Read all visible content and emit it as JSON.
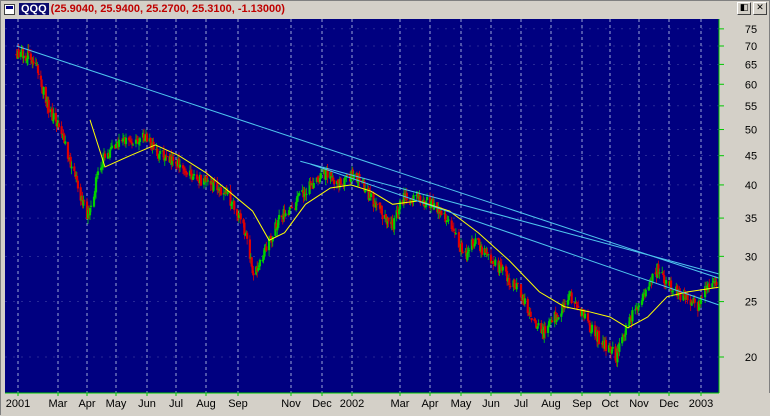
{
  "window": {
    "symbol": "QQQ",
    "quote_values": "(25.9040, 25.9400, 25.2700, 25.3100, -1.13000)",
    "buttons": {
      "restore": "◧",
      "close": "✕"
    }
  },
  "colors": {
    "plot_bg": "#000080",
    "grid": "#9da6d6",
    "up": "#00d000",
    "down": "#e00000",
    "moving_average": "#ffff00",
    "trendline": "#4fc6ee",
    "axis_text": "#000000",
    "axis_frame": "#00c800"
  },
  "chart_data": {
    "type": "candlestick",
    "series_label": "QQQ",
    "y_scale": "log",
    "ylim": [
      18,
      76
    ],
    "y_ticks": [
      20,
      25,
      30,
      35,
      40,
      45,
      50,
      55,
      60,
      65,
      70,
      75
    ],
    "x_ticks": [
      "2001",
      "Mar",
      "Apr",
      "May",
      "Jun",
      "Jul",
      "Aug",
      "Sep",
      "Nov",
      "Dec",
      "2002",
      "Mar",
      "Apr",
      "May",
      "Jun",
      "Jul",
      "Aug",
      "Sep",
      "Oct",
      "Nov",
      "Dec",
      "2003"
    ],
    "price_path": [
      [
        "2001-01-02",
        68
      ],
      [
        "2001-01-25",
        67
      ],
      [
        "2001-02-15",
        55
      ],
      [
        "2001-03-05",
        49
      ],
      [
        "2001-03-20",
        41
      ],
      [
        "2001-04-04",
        35
      ],
      [
        "2001-04-10",
        40
      ],
      [
        "2001-04-20",
        45
      ],
      [
        "2001-05-05",
        47
      ],
      [
        "2001-05-20",
        48
      ],
      [
        "2001-05-28",
        49
      ],
      [
        "2001-06-10",
        46
      ],
      [
        "2001-06-25",
        44
      ],
      [
        "2001-07-10",
        43
      ],
      [
        "2001-07-25",
        41
      ],
      [
        "2001-08-10",
        40
      ],
      [
        "2001-08-25",
        38
      ],
      [
        "2001-09-10",
        34
      ],
      [
        "2001-09-21",
        28
      ],
      [
        "2001-10-05",
        31
      ],
      [
        "2001-10-20",
        35
      ],
      [
        "2001-11-05",
        37
      ],
      [
        "2001-11-20",
        40
      ],
      [
        "2001-12-05",
        42
      ],
      [
        "2001-12-20",
        40
      ],
      [
        "2002-01-05",
        42
      ],
      [
        "2002-01-20",
        39
      ],
      [
        "2002-02-05",
        36
      ],
      [
        "2002-02-20",
        34
      ],
      [
        "2002-03-05",
        38
      ],
      [
        "2002-03-20",
        38
      ],
      [
        "2002-04-05",
        37
      ],
      [
        "2002-04-20",
        34
      ],
      [
        "2002-05-05",
        30
      ],
      [
        "2002-05-15",
        32
      ],
      [
        "2002-06-01",
        30
      ],
      [
        "2002-06-15",
        28
      ],
      [
        "2002-06-30",
        26
      ],
      [
        "2002-07-15",
        23
      ],
      [
        "2002-07-24",
        22
      ],
      [
        "2002-08-10",
        24
      ],
      [
        "2002-08-22",
        25.5
      ],
      [
        "2002-09-05",
        23.5
      ],
      [
        "2002-09-20",
        21.5
      ],
      [
        "2002-10-08",
        20
      ],
      [
        "2002-10-20",
        23
      ],
      [
        "2002-11-05",
        25.5
      ],
      [
        "2002-11-20",
        28.5
      ],
      [
        "2002-12-01",
        27
      ],
      [
        "2002-12-15",
        25.5
      ],
      [
        "2002-12-31",
        24.5
      ],
      [
        "2003-01-08",
        26.5
      ],
      [
        "2003-01-14",
        27.5
      ],
      [
        "2003-01-20",
        25.3
      ]
    ],
    "moving_average_path": [
      [
        "2001-04-05",
        52
      ],
      [
        "2001-04-20",
        43
      ],
      [
        "2001-05-15",
        45
      ],
      [
        "2001-06-10",
        47
      ],
      [
        "2001-07-05",
        45
      ],
      [
        "2001-08-01",
        42
      ],
      [
        "2001-08-25",
        39
      ],
      [
        "2001-09-20",
        36
      ],
      [
        "2001-10-08",
        32
      ],
      [
        "2001-10-25",
        33
      ],
      [
        "2001-11-15",
        37
      ],
      [
        "2001-12-10",
        39.5
      ],
      [
        "2002-01-01",
        40
      ],
      [
        "2002-01-25",
        39
      ],
      [
        "2002-02-20",
        37
      ],
      [
        "2002-03-20",
        37.5
      ],
      [
        "2002-04-20",
        36
      ],
      [
        "2002-05-20",
        33
      ],
      [
        "2002-06-20",
        29.5
      ],
      [
        "2002-07-20",
        26
      ],
      [
        "2002-08-15",
        24.5
      ],
      [
        "2002-09-10",
        24
      ],
      [
        "2002-10-01",
        23.5
      ],
      [
        "2002-10-20",
        22.5
      ],
      [
        "2002-11-10",
        23.5
      ],
      [
        "2002-11-30",
        25.5
      ],
      [
        "2002-12-20",
        26
      ],
      [
        "2003-01-20",
        26.5
      ]
    ],
    "trendlines": [
      {
        "from": [
          "2001-01-02",
          70
        ],
        "to": [
          "2003-01-24",
          27.3
        ]
      },
      {
        "from": [
          "2001-11-10",
          44
        ],
        "to": [
          "2003-01-24",
          27.8
        ]
      },
      {
        "from": [
          "2001-11-20",
          43.5
        ],
        "to": [
          "2003-01-24",
          24.5
        ]
      }
    ]
  }
}
